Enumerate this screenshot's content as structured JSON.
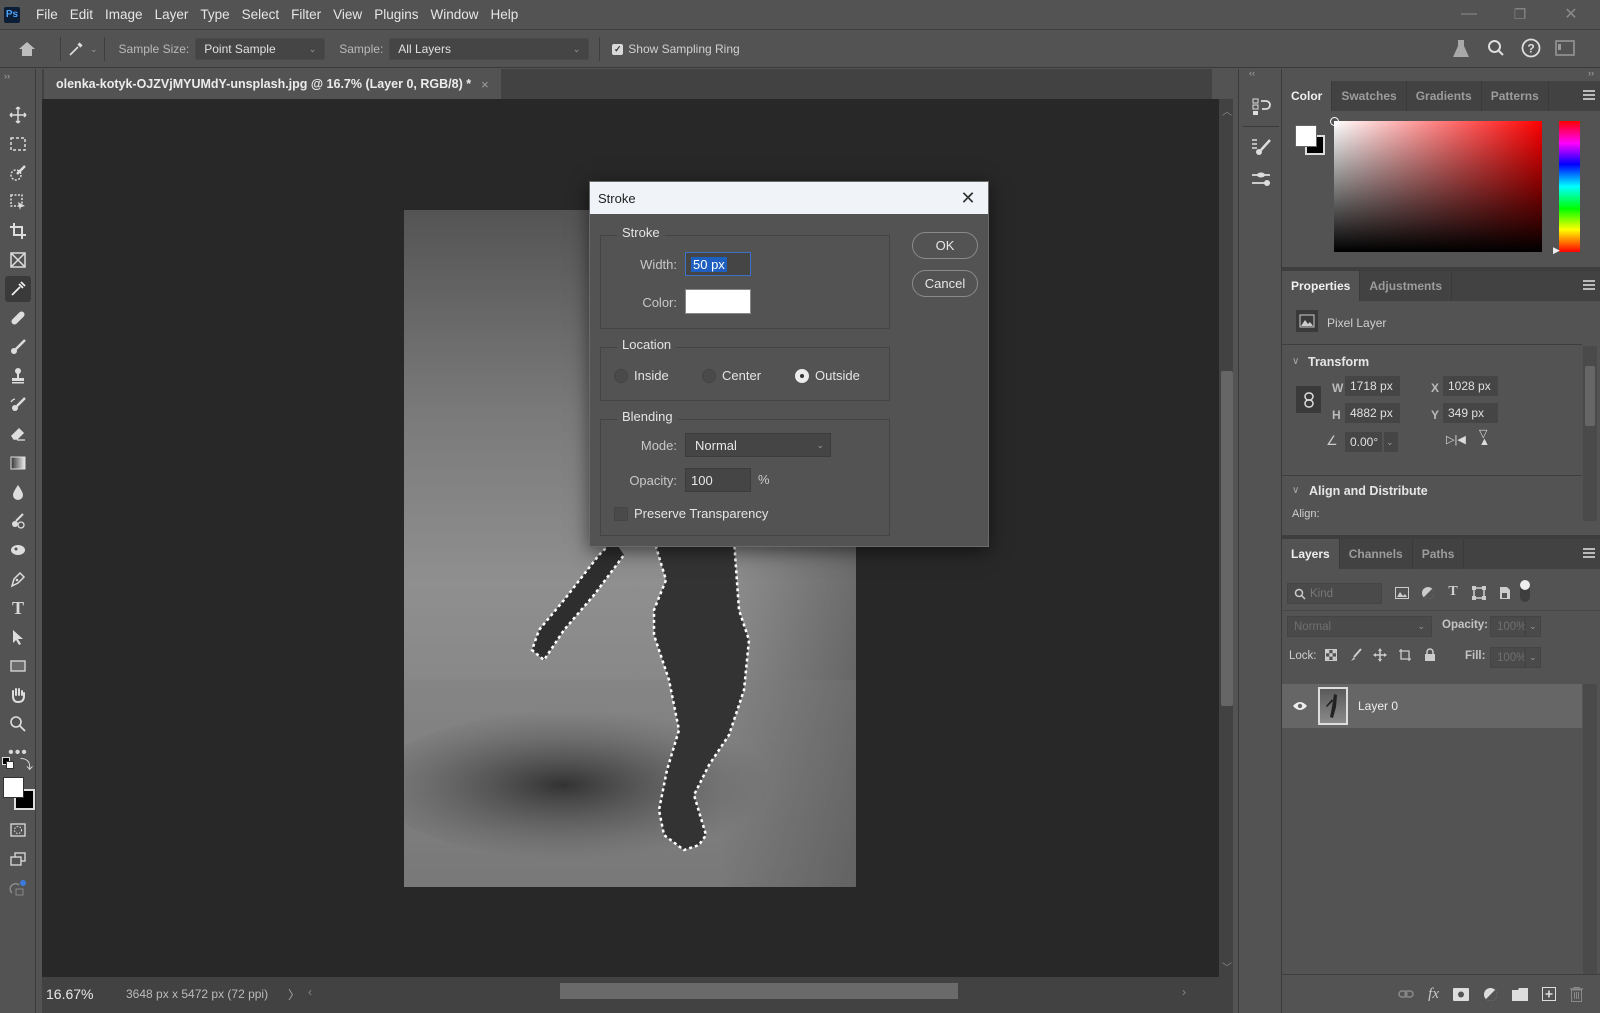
{
  "app": {
    "logo": "Ps",
    "menu": [
      "File",
      "Edit",
      "Image",
      "Layer",
      "Type",
      "Select",
      "Filter",
      "View",
      "Plugins",
      "Window",
      "Help"
    ],
    "window_controls": {
      "minimize": "—",
      "restore": "❐",
      "close": "✕"
    }
  },
  "options_bar": {
    "sample_size_label": "Sample Size:",
    "sample_size_value": "Point Sample",
    "sample_label": "Sample:",
    "sample_value": "All Layers",
    "show_sampling_ring_label": "Show Sampling Ring",
    "show_sampling_ring_checked": true
  },
  "toolbar": {
    "active_tool": "eyedropper",
    "tools": [
      "move",
      "rectangular-marquee",
      "object-selection",
      "artboard",
      "crop",
      "frame",
      "eyedropper",
      "healing-brush",
      "brush",
      "clone-stamp",
      "history-brush",
      "eraser",
      "gradient",
      "blur",
      "dodge",
      "smudge",
      "pen",
      "type",
      "path-selection",
      "rectangle",
      "hand",
      "zoom",
      "more-tools",
      "default-colors",
      "swap-colors",
      "foreground-background",
      "quick-mask",
      "screen-mode",
      "generative"
    ],
    "foreground_color": "#ffffff",
    "background_color": "#000000"
  },
  "document": {
    "tab_title": "olenka-kotyk-OJZVjMYUMdY-unsplash.jpg @ 16.7% (Layer 0, RGB/8) *",
    "tab_close": "×",
    "zoom": "16.67%",
    "doc_info": "3648 px x 5472 px (72 ppi)",
    "status_arrow": "〉"
  },
  "dialog": {
    "title": "Stroke",
    "close": "✕",
    "stroke_group": "Stroke",
    "width_label": "Width:",
    "width_value": "50 px",
    "color_label": "Color:",
    "color_value": "#ffffff",
    "location_group": "Location",
    "location_options": [
      {
        "label": "Inside",
        "selected": false
      },
      {
        "label": "Center",
        "selected": false
      },
      {
        "label": "Outside",
        "selected": true
      }
    ],
    "blending_group": "Blending",
    "mode_label": "Mode:",
    "mode_value": "Normal",
    "opacity_label": "Opacity:",
    "opacity_value": "100",
    "opacity_unit": "%",
    "preserve_transparency_label": "Preserve Transparency",
    "preserve_transparency_checked": false,
    "ok_label": "OK",
    "cancel_label": "Cancel"
  },
  "color_panel": {
    "tabs": [
      "Color",
      "Swatches",
      "Gradients",
      "Patterns"
    ],
    "active_tab": "Color",
    "hue": "#ff0000"
  },
  "properties_panel": {
    "tabs": [
      "Properties",
      "Adjustments"
    ],
    "active_tab": "Properties",
    "layer_type": "Pixel Layer",
    "transform_header": "Transform",
    "w_label": "W",
    "w_value": "1718 px",
    "h_label": "H",
    "h_value": "4882 px",
    "x_label": "X",
    "x_value": "1028 px",
    "y_label": "Y",
    "y_value": "349 px",
    "angle_value": "0.00°",
    "align_header": "Align and Distribute",
    "align_label": "Align:"
  },
  "layers_panel": {
    "tabs": [
      "Layers",
      "Channels",
      "Paths"
    ],
    "active_tab": "Layers",
    "filter_placeholder": "Kind",
    "blend_mode": "Normal",
    "opacity_label": "Opacity:",
    "opacity_value": "100%",
    "lock_label": "Lock:",
    "fill_label": "Fill:",
    "fill_value": "100%",
    "layers": [
      {
        "name": "Layer 0",
        "visible": true,
        "selected": true
      }
    ],
    "footer_icons": [
      "link-icon",
      "fx-icon",
      "mask-icon",
      "adjustment-icon",
      "group-folder-icon",
      "new-layer-icon",
      "trash-icon"
    ]
  }
}
